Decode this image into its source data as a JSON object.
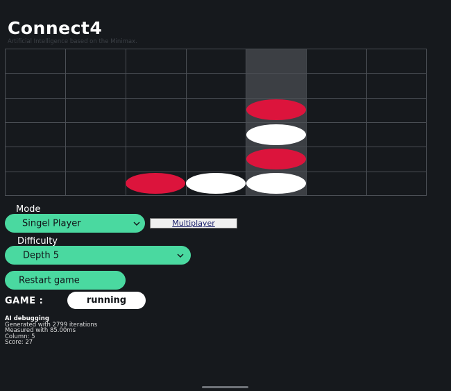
{
  "header": {
    "title": "Connect4",
    "subtitle": "Artificial Intelligence based on the Minimax."
  },
  "board": {
    "columns": 7,
    "rows": 6,
    "highlighted_column": 4,
    "discs": [
      {
        "row": 2,
        "col": 4,
        "color": "red"
      },
      {
        "row": 3,
        "col": 4,
        "color": "white"
      },
      {
        "row": 4,
        "col": 4,
        "color": "red"
      },
      {
        "row": 5,
        "col": 2,
        "color": "red"
      },
      {
        "row": 5,
        "col": 3,
        "color": "white"
      },
      {
        "row": 5,
        "col": 4,
        "color": "white"
      }
    ],
    "colors": {
      "red": "#dc143c",
      "white": "#ffffff",
      "grid": "#4b4f55",
      "highlight": "#3c3f44"
    }
  },
  "controls": {
    "mode_label": "Mode",
    "mode_value": "Singel Player",
    "multiplayer_label": "Multiplayer",
    "difficulty_label": "Difficulty",
    "difficulty_value": "Depth 5",
    "restart_label": "Restart game",
    "accent_color": "#4ad9a0"
  },
  "game": {
    "label": "GAME :",
    "status": "running"
  },
  "debug": {
    "heading": "AI debugging",
    "lines": [
      "Generated with 2799 iterations",
      "Measured with 85.00ms",
      "Column: 5",
      "Score: 27"
    ]
  },
  "icons": {
    "dropdown": "chevron-down-icon"
  }
}
